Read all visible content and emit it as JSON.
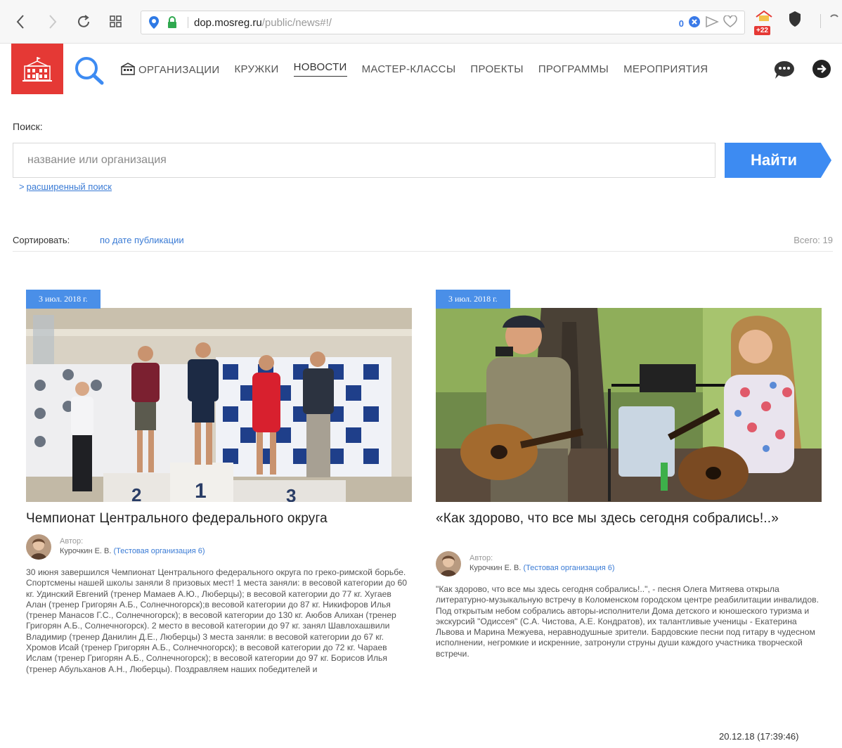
{
  "browser": {
    "url_host": "dop.mosreg.ru",
    "url_path": "/public/news#!/",
    "notification_count": "0",
    "ext_badge": "+22"
  },
  "nav": {
    "items": [
      "ОРГАНИЗАЦИИ",
      "КРУЖКИ",
      "НОВОСТИ",
      "МАСТЕР-КЛАССЫ",
      "ПРОЕКТЫ",
      "ПРОГРАММЫ",
      "МЕРОПРИЯТИЯ"
    ],
    "active": "НОВОСТИ"
  },
  "search": {
    "label": "Поиск:",
    "placeholder": "название или организация",
    "button": "Найти",
    "advanced": "расширенный поиск"
  },
  "sort": {
    "label": "Сортировать:",
    "value": "по дате публикации",
    "total": "Всего: 19"
  },
  "news": [
    {
      "date": "3 июл. 2018 г.",
      "title": "Чемпионат Центрального федерального округа",
      "author_label": "Автор:",
      "author": "Курочкин Е. В.",
      "organization": "(Тестовая организация 6)",
      "text": "30 июня завершился Чемпионат Центрального федерального округа по греко-римской борьбе. Спортсмены нашей школы заняли 8 призовых мест! 1 места заняли: в весовой категории до 60 кг. Удинский Евгений (тренер Мамаев А.Ю., Люберцы); в весовой категории до 77 кг. Хугаев Алан (тренер Григорян А.Б., Солнечногорск);в весовой категории до 87 кг. Никифоров Илья (тренер Манасов Г.С., Солнечногорск); в весовой категории до 130 кг. Аюбов Алихан (тренер Григорян А.Б., Солнечногорск). 2 место в весовой категории до 97 кг. занял Шавлохашвили Владимир (тренер Данилин Д.Е., Люберцы) 3 места заняли: в весовой категории до 67 кг. Хромов Исай (тренер Григорян А.Б., Солнечногорск); в весовой категории до 72 кг. Чараев Ислам (тренер Григорян А.Б., Солнечногорск); в весовой категории до 97 кг. Борисов Илья (тренер Абульханов А.Н., Люберцы). Поздравляем наших победителей и"
    },
    {
      "date": "3 июл. 2018 г.",
      "title": "«Как здорово, что все мы здесь сегодня собрались!..»",
      "author_label": "Автор:",
      "author": "Курочкин Е. В.",
      "organization": "(Тестовая организация 6)",
      "text": "\"Как здорово, что все мы здесь сегодня собрались!..\", - песня Олега Митяева открыла литературно-музыкальную встречу в Коломенском городском центре реабилитации инвалидов. Под открытым небом собрались авторы-исполнители Дома детского и юношеского туризма и экскурсий \"Одиссея\" (С.А. Чистова, А.Е. Кондратов), их талантливые ученицы - Екатерина Львова и Марина Межуева, неравнодушные зрители. Бардовские песни под гитару в чудесном исполнении, негромкие и искренние, затронули струны души каждого участника творческой встречи."
    }
  ],
  "footer": {
    "timestamp": "20.12.18 (17:39:46)"
  },
  "colors": {
    "brand_red": "#e53935",
    "accent_blue": "#3d8bf2",
    "link_blue": "#3a7bd5"
  }
}
